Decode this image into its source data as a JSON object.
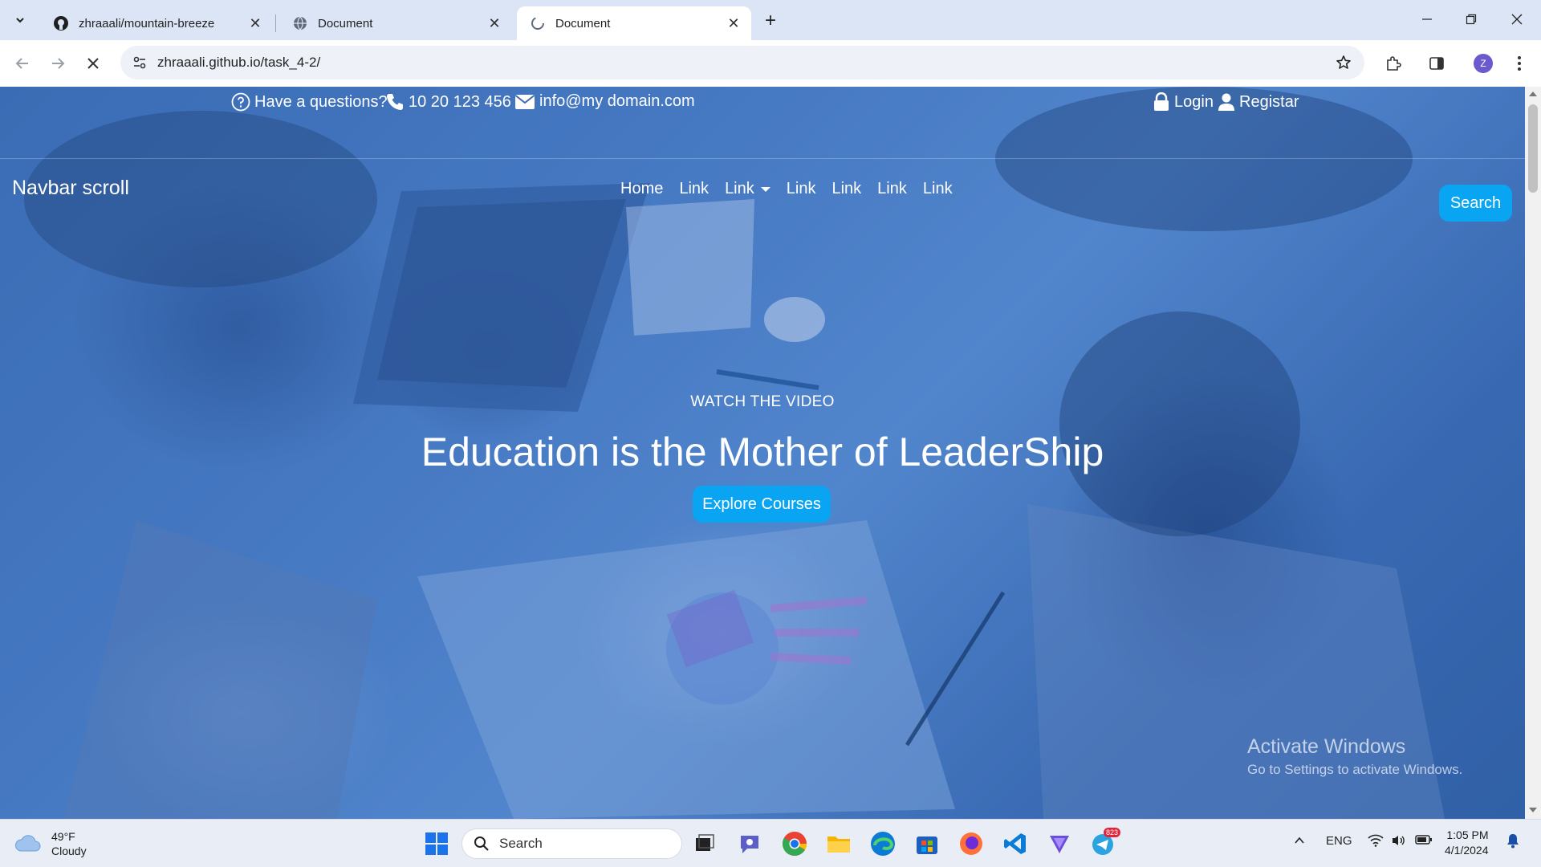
{
  "browser": {
    "tabs": [
      {
        "title": "zhraaali/mountain-breeze",
        "icon": "github-icon"
      },
      {
        "title": "Document",
        "icon": "globe-icon"
      },
      {
        "title": "Document",
        "icon": "loading-globe-icon",
        "active": true
      }
    ],
    "url": "zhraaali.github.io/task_4-2/",
    "profile_initial": "Z"
  },
  "page": {
    "topbar": {
      "question": "Have a questions?",
      "phone": "10 20 123 456",
      "email": "info@my domain.com",
      "login": "Login",
      "register": "Registar"
    },
    "navbar": {
      "brand": "Navbar scroll",
      "links": [
        "Home",
        "Link",
        "Link",
        "Link",
        "Link",
        "Link",
        "Link"
      ],
      "search_button": "Search"
    },
    "hero": {
      "eyebrow": "WATCH THE VIDEO",
      "headline": "Education is the Mother of LeaderShip",
      "cta": "Explore Courses"
    },
    "watermark": {
      "title": "Activate Windows",
      "subtitle": "Go to Settings to activate Windows."
    }
  },
  "taskbar": {
    "weather_temp": "49°F",
    "weather_desc": "Cloudy",
    "search_label": "Search",
    "telegram_badge": "823",
    "language": "ENG",
    "time": "1:05 PM",
    "date": "4/1/2024"
  },
  "colors": {
    "accent": "#0aa5f2",
    "hero_tint": "#3f6fb2"
  }
}
